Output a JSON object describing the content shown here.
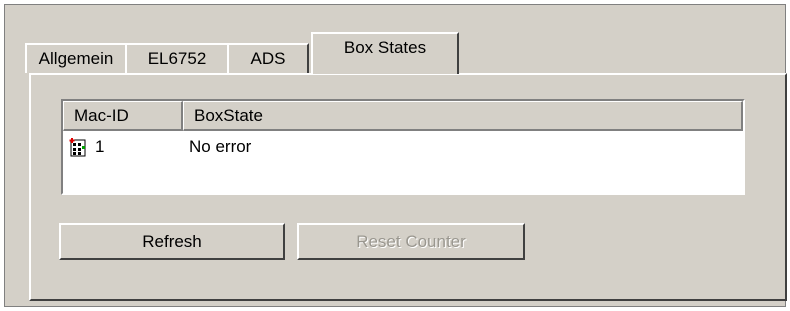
{
  "tabs": [
    {
      "label": "Allgemein"
    },
    {
      "label": "EL6752"
    },
    {
      "label": "ADS"
    },
    {
      "label": "Box States"
    }
  ],
  "list": {
    "columns": [
      "Mac-ID",
      "BoxState"
    ],
    "rows": [
      {
        "mac_id": "1",
        "box_state": "No error",
        "icon": "box-device-icon"
      }
    ]
  },
  "buttons": {
    "refresh": "Refresh",
    "reset_counter": "Reset Counter"
  }
}
